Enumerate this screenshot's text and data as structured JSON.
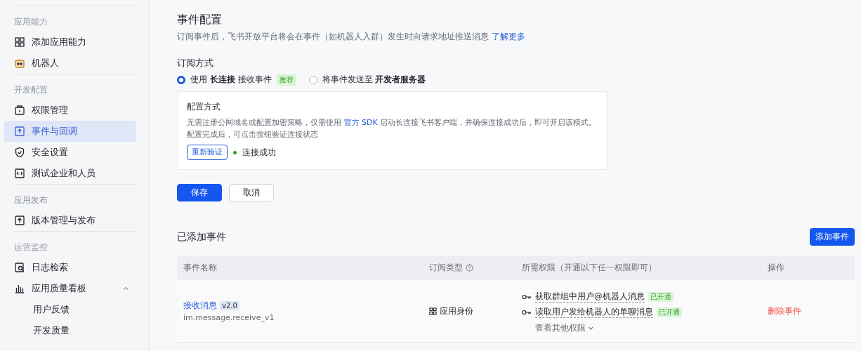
{
  "sidebar": {
    "sections": [
      {
        "title": "应用能力",
        "items": [
          {
            "label": "添加应用能力",
            "selected": false
          },
          {
            "label": "机器人",
            "selected": false
          }
        ]
      },
      {
        "title": "开发配置",
        "items": [
          {
            "label": "权限管理",
            "selected": false
          },
          {
            "label": "事件与回调",
            "selected": true
          },
          {
            "label": "安全设置",
            "selected": false
          },
          {
            "label": "测试企业和人员",
            "selected": false
          }
        ]
      },
      {
        "title": "应用发布",
        "items": [
          {
            "label": "版本管理与发布",
            "selected": false
          }
        ]
      },
      {
        "title": "运营监控",
        "items": [
          {
            "label": "日志检索",
            "selected": false
          },
          {
            "label": "应用质量看板",
            "selected": false,
            "expanded": true,
            "children": [
              {
                "label": "用户反馈",
                "selected": false
              },
              {
                "label": "开发质量",
                "selected": false
              }
            ]
          }
        ]
      }
    ]
  },
  "event_config": {
    "title": "事件配置",
    "description": "订阅事件后，飞书开放平台将会在事件（如机器人入群）发生时向请求地址推送消息",
    "learn_more": "了解更多",
    "subscription": {
      "label": "订阅方式",
      "options": [
        {
          "label": "使用 **长连接** 接收事件",
          "badge": "推荐",
          "selected": true
        },
        {
          "label": "将事件发送至 **开发者服务器**",
          "selected": false
        }
      ]
    },
    "config_box": {
      "title": "配置方式",
      "text_before": "无需注册公网域名或配置加密策略，仅需使用",
      "link": "官方 SDK",
      "text_after": "启动长连接飞书客户端，并确保连接成功后，即可开启该模式。",
      "text_line2": "配置完成后，可点击按钮验证连接状态",
      "verify_button": "重新验证",
      "status": "连接成功",
      "connected": true
    },
    "buttons": [
      {
        "label": "保存",
        "primary": true
      },
      {
        "label": "取消",
        "primary": false
      }
    ]
  },
  "added_events": {
    "title": "已添加事件",
    "add_button": "添加事件",
    "table": {
      "columns": [
        "事件名称",
        "订阅类型",
        "所需权限（开通以下任一权限即可）",
        "操作"
      ],
      "rows": [
        {
          "name": "接收消息",
          "version": "v2.0",
          "code": "im.message.receive_v1",
          "type": "应用身份",
          "permissions": [
            {
              "label": "获取群组中用户@机器人消息",
              "status": "已开通"
            },
            {
              "label": "读取用户发给机器人的单聊消息",
              "status": "已开通"
            }
          ],
          "more": "查看其他权限",
          "action": "删除事件"
        }
      ]
    }
  }
}
